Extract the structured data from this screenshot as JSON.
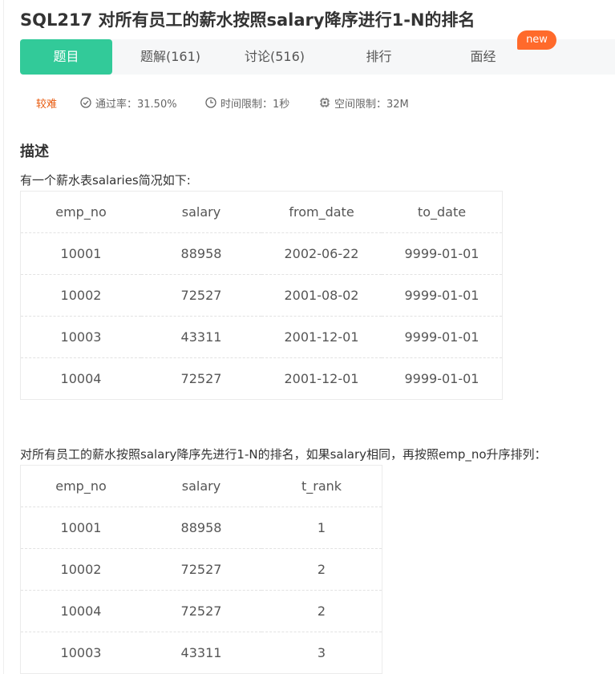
{
  "problem": {
    "title": "SQL217  对所有员工的薪水按照salary降序进行1-N的排名"
  },
  "tabs": [
    {
      "label": "题目"
    },
    {
      "label": "题解(161)"
    },
    {
      "label": "讨论(516)"
    },
    {
      "label": "排行"
    },
    {
      "label": "面经"
    }
  ],
  "new_badge": "new",
  "meta": {
    "difficulty": "较难",
    "pass_rate": "通过率：31.50%",
    "time_limit": "时间限制：1秒",
    "space_limit": "空间限制：32M"
  },
  "description": {
    "heading": "描述",
    "intro": "有一个薪水表salaries简况如下:",
    "task": "对所有员工的薪水按照salary降序先进行1-N的排名，如果salary相同，再按照emp_no升序排列："
  },
  "salaries_table": {
    "headers": [
      "emp_no",
      "salary",
      "from_date",
      "to_date"
    ],
    "rows": [
      [
        "10001",
        "88958",
        "2002-06-22",
        "9999-01-01"
      ],
      [
        "10002",
        "72527",
        "2001-08-02",
        "9999-01-01"
      ],
      [
        "10003",
        "43311",
        "2001-12-01",
        "9999-01-01"
      ],
      [
        "10004",
        "72527",
        "2001-12-01",
        "9999-01-01"
      ]
    ]
  },
  "result_table": {
    "headers": [
      "emp_no",
      "salary",
      "t_rank"
    ],
    "rows": [
      [
        "10001",
        "88958",
        "1"
      ],
      [
        "10002",
        "72527",
        "2"
      ],
      [
        "10004",
        "72527",
        "2"
      ],
      [
        "10003",
        "43311",
        "3"
      ]
    ]
  },
  "colors": {
    "accent": "#32ca99",
    "badge": "#ff6a2b",
    "difficulty": "#e8590c"
  },
  "icons": [
    "check-circle-icon",
    "clock-icon",
    "chip-icon"
  ]
}
